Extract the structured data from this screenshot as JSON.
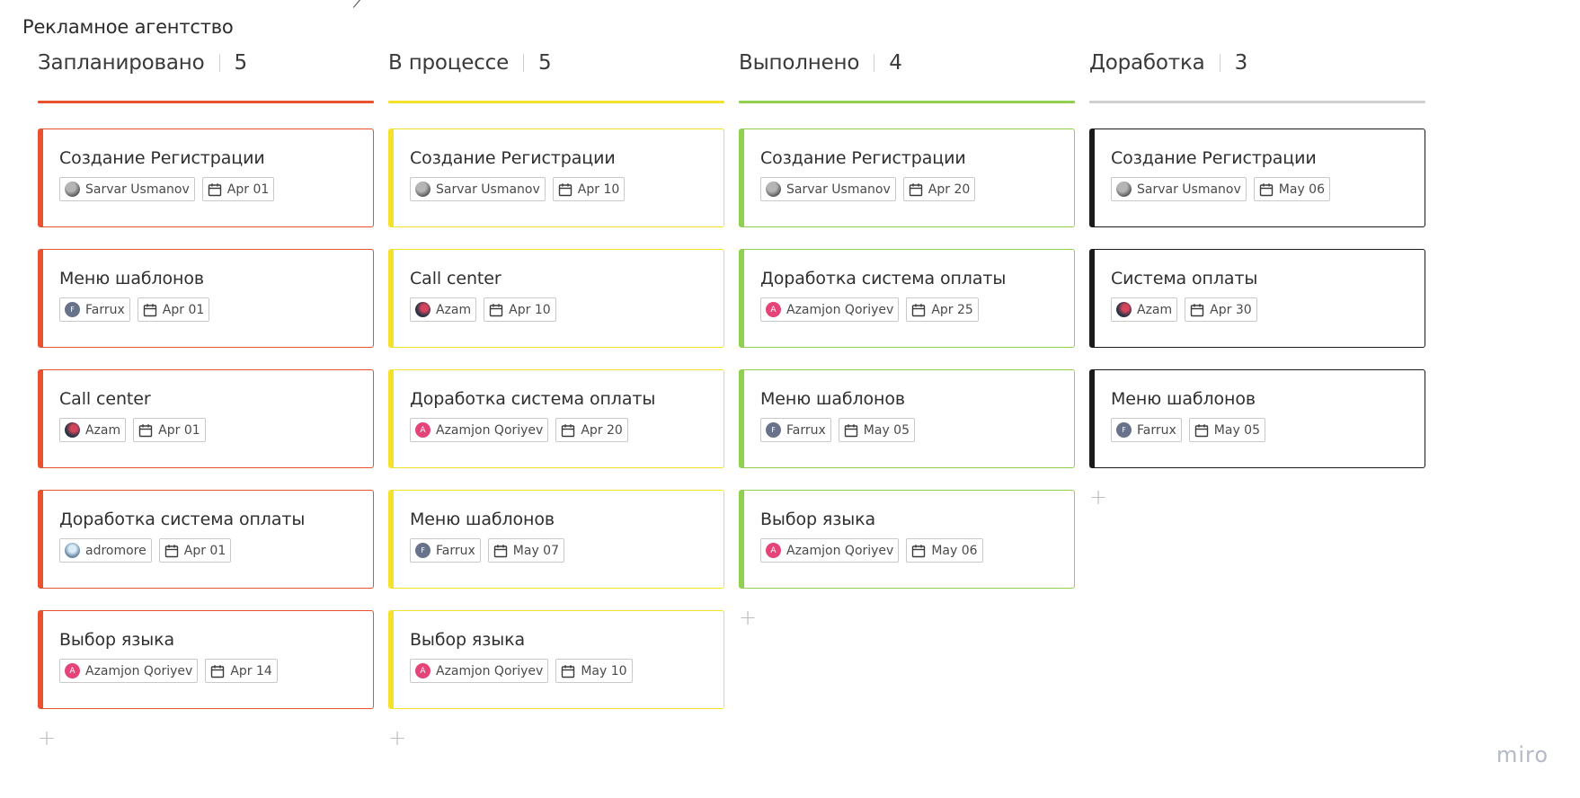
{
  "board": {
    "title": "Рекламное агентство",
    "brand": "miro",
    "add_symbol": "+"
  },
  "columns": [
    {
      "title": "Запланировано",
      "count": "5",
      "color": "#e8532e",
      "cards": [
        {
          "title": "Создание Регистрации",
          "assignee": "Sarvar Usmanov",
          "avatar": "gray",
          "date": "Apr 01"
        },
        {
          "title": "Меню шаблонов",
          "assignee": "Farrux",
          "avatar": "slate",
          "initial": "F",
          "date": "Apr 01"
        },
        {
          "title": "Call center",
          "assignee": "Azam",
          "avatar": "dark",
          "date": "Apr 01"
        },
        {
          "title": "Доработка система оплаты",
          "assignee": "adromore",
          "avatar": "photo",
          "date": "Apr 01"
        },
        {
          "title": "Выбор языка",
          "assignee": "Azamjon Qoriyev",
          "avatar": "pink",
          "initial": "A",
          "date": "Apr 14"
        }
      ]
    },
    {
      "title": "В процессе",
      "count": "5",
      "color": "#f4e12c",
      "cards": [
        {
          "title": "Создание Регистрации",
          "assignee": "Sarvar Usmanov",
          "avatar": "gray",
          "date": "Apr 10"
        },
        {
          "title": "Call center",
          "assignee": "Azam",
          "avatar": "dark",
          "date": "Apr 10"
        },
        {
          "title": "Доработка система оплаты",
          "assignee": "Azamjon Qoriyev",
          "avatar": "pink",
          "initial": "A",
          "date": "Apr 20"
        },
        {
          "title": "Меню шаблонов",
          "assignee": "Farrux",
          "avatar": "slate",
          "initial": "F",
          "date": "May 07"
        },
        {
          "title": "Выбор языка",
          "assignee": "Azamjon Qoriyev",
          "avatar": "pink",
          "initial": "A",
          "date": "May 10"
        }
      ]
    },
    {
      "title": "Выполнено",
      "count": "4",
      "color": "#8fd14f",
      "cards": [
        {
          "title": "Создание Регистрации",
          "assignee": "Sarvar Usmanov",
          "avatar": "gray",
          "date": "Apr 20"
        },
        {
          "title": "Доработка система оплаты",
          "assignee": "Azamjon Qoriyev",
          "avatar": "pink",
          "initial": "A",
          "date": "Apr 25"
        },
        {
          "title": "Меню шаблонов",
          "assignee": "Farrux",
          "avatar": "slate",
          "initial": "F",
          "date": "May 05"
        },
        {
          "title": "Выбор языка",
          "assignee": "Azamjon Qoriyev",
          "avatar": "pink",
          "initial": "A",
          "date": "May 06"
        }
      ]
    },
    {
      "title": "Доработка",
      "count": "3",
      "color": "#1a1a1a",
      "header_line_color": "#d0d0d0",
      "cards": [
        {
          "title": "Создание Регистрации",
          "assignee": "Sarvar Usmanov",
          "avatar": "gray",
          "date": "May 06"
        },
        {
          "title": "Система оплаты",
          "assignee": "Azam",
          "avatar": "dark",
          "date": "Apr 30"
        },
        {
          "title": "Меню шаблонов",
          "assignee": "Farrux",
          "avatar": "slate",
          "initial": "F",
          "date": "May 05"
        }
      ]
    }
  ]
}
